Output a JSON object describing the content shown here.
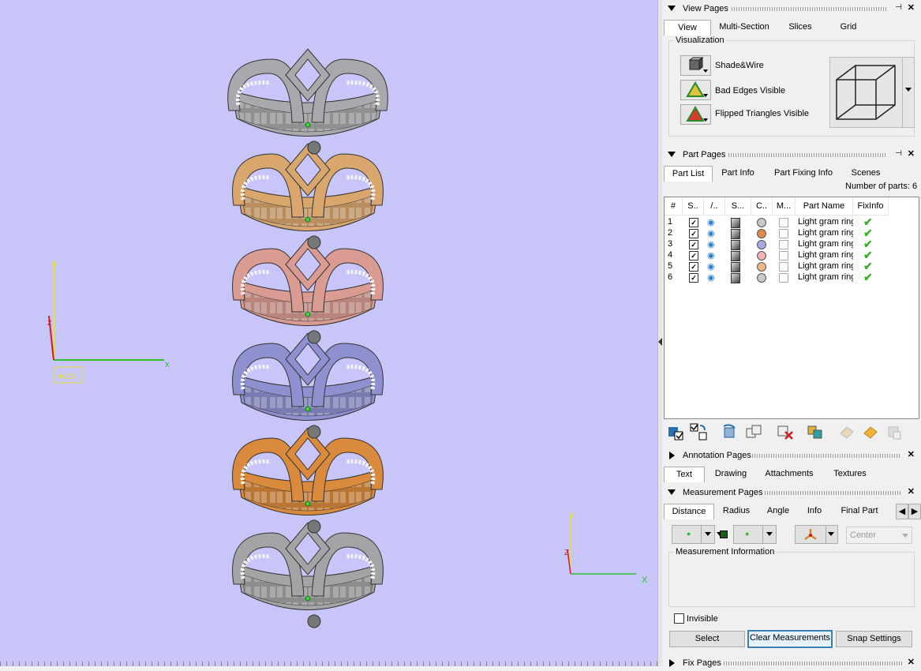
{
  "viewport": {
    "axis_main": {
      "x": "x",
      "y": "y",
      "z": "z",
      "label": "WCS"
    },
    "axis_corner": {
      "x": "X",
      "y": "Y",
      "z": "Z"
    },
    "rings": [
      {
        "color": "#a9a9ad",
        "name": "silver"
      },
      {
        "color": "#d9a66e",
        "name": "gold"
      },
      {
        "color": "#d99b92",
        "name": "rose"
      },
      {
        "color": "#8f90cf",
        "name": "blue"
      },
      {
        "color": "#d98a3c",
        "name": "orange"
      },
      {
        "color": "#a4a4a6",
        "name": "silver"
      }
    ]
  },
  "view_pages": {
    "title": "View Pages",
    "tabs": [
      "View",
      "Multi-Section",
      "Slices",
      "Grid"
    ],
    "active_tab": "View",
    "visualization_label": "Visualization",
    "options": [
      "Shade&Wire",
      "Bad Edges Visible",
      "Flipped Triangles Visible"
    ]
  },
  "part_pages": {
    "title": "Part Pages",
    "tabs": [
      "Part List",
      "Part Info",
      "Part Fixing Info",
      "Scenes"
    ],
    "active_tab": "Part List",
    "count_label": "Number of parts: 6",
    "columns": [
      "#",
      "S..",
      "/..",
      "S...",
      "C..",
      "M...",
      "Part Name",
      "FixInfo"
    ],
    "rows": [
      {
        "n": "1",
        "name": "Light gram ring",
        "color": "#c9c9c9"
      },
      {
        "n": "2",
        "name": "Light gram ring",
        "color": "#e08a4c"
      },
      {
        "n": "3",
        "name": "Light gram ring",
        "color": "#a9a9e6"
      },
      {
        "n": "4",
        "name": "Light gram ring",
        "color": "#f0b3b3"
      },
      {
        "n": "5",
        "name": "Light gram ring",
        "color": "#f0b888"
      },
      {
        "n": "6",
        "name": "Light gram ring",
        "color": "#c9c9c9"
      }
    ],
    "toolbar_icons": [
      "select-all-parts-icon",
      "toggle-selection-icon",
      "rotate-part-icon",
      "duplicate-part-icon",
      "delete-part-icon",
      "merge-parts-icon",
      "pack-parts-icon",
      "export-parts-icon",
      "properties-icon"
    ]
  },
  "annotation_pages": {
    "title": "Annotation Pages",
    "tabs": [
      "Text",
      "Drawing",
      "Attachments",
      "Textures"
    ],
    "active_tab": "Text"
  },
  "measurement_pages": {
    "title": "Measurement Pages",
    "tabs": [
      "Distance",
      "Radius",
      "Angle",
      "Info",
      "Final Part"
    ],
    "active_tab": "Distance",
    "center_select": "Center",
    "info_label": "Measurement Information",
    "invisible_label": "Invisible",
    "buttons": {
      "select": "Select",
      "clear": "Clear Measurements",
      "snap": "Snap Settings"
    }
  },
  "fix_pages": {
    "title": "Fix Pages"
  }
}
